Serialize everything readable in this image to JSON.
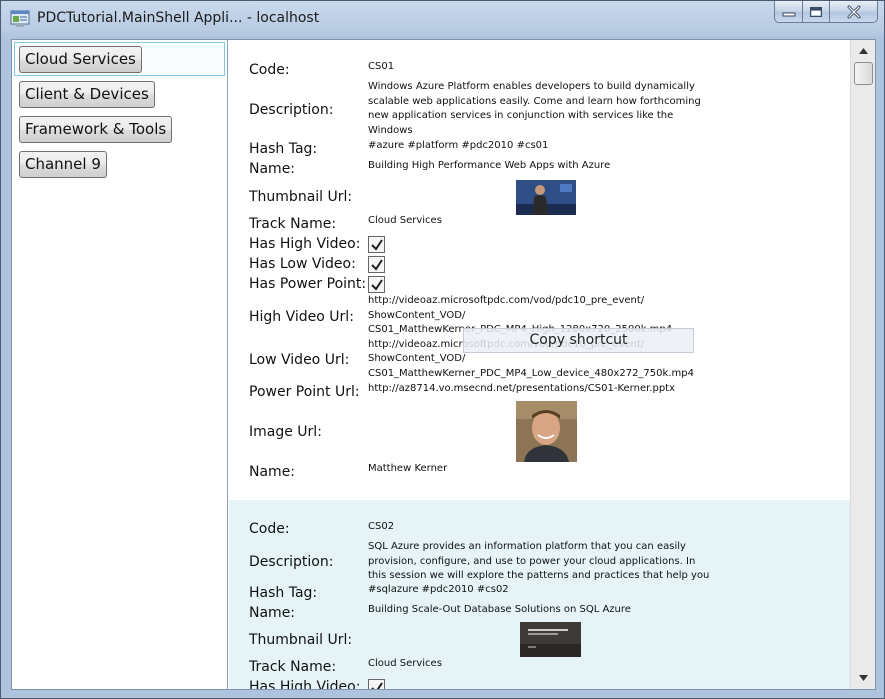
{
  "window": {
    "title": "PDCTutorial.MainShell Appli... - localhost"
  },
  "sidebar": {
    "items": [
      {
        "label": "Cloud Services",
        "selected": true
      },
      {
        "label": "Client & Devices"
      },
      {
        "label": "Framework & Tools"
      },
      {
        "label": "Channel 9"
      }
    ]
  },
  "labels": {
    "code": "Code:",
    "description": "Description:",
    "hash_tag": "Hash Tag:",
    "name": "Name:",
    "thumbnail_url": "Thumbnail Url:",
    "track_name": "Track Name:",
    "has_high_video": "Has High Video:",
    "has_low_video": "Has Low Video:",
    "has_power_point": "Has Power Point:",
    "high_video_url": "High Video Url:",
    "low_video_url": "Low Video Url:",
    "power_point_url": "Power Point Url:",
    "image_url": "Image Url:",
    "speaker_name": "Name:"
  },
  "records": [
    {
      "code": "CS01",
      "description": "Windows Azure Platform enables developers to build dynamically scalable web applications easily. Come and learn how forthcoming new application services  in conjunction with services like the Windows",
      "hash_tag": "#azure #platform #pdc2010 #cs01",
      "name": "Building High Performance Web Apps with Azure",
      "track_name": "Cloud Services",
      "has_high_video": true,
      "has_low_video": true,
      "has_power_point": true,
      "high_video_url_lines": [
        "http://videoaz.microsoftpdc.com/vod/pdc10_pre_event/",
        "ShowContent_VOD/",
        "CS01_MatthewKerner_PDC_MP4_High_1280x720_2500k.mp4"
      ],
      "low_video_url_lines": [
        "http://videoaz.microsoftpdc.com/vod/pdc10_pre_event/",
        "ShowContent_VOD/",
        "CS01_MatthewKerner_PDC_MP4_Low_device_480x272_750k.mp4"
      ],
      "power_point_url": "http://az8714.vo.msecnd.net/presentations/CS01-Kerner.pptx",
      "speaker_name": "Matthew Kerner"
    },
    {
      "code": "CS02",
      "description": "SQL Azure provides an information platform that you can easily provision, configure, and use to power your cloud applications.  In this session we will explore the patterns and practices that help you",
      "hash_tag": "#sqlazure #pdc2010 #cs02",
      "name": "Building Scale-Out Database Solutions on SQL Azure",
      "track_name": "Cloud Services",
      "has_high_video": true
    }
  ],
  "tooltip": {
    "text": "Copy shortcut"
  },
  "colors": {
    "selected_border": "#7fc8e8",
    "alt_row_background": "#e6f4f7"
  }
}
